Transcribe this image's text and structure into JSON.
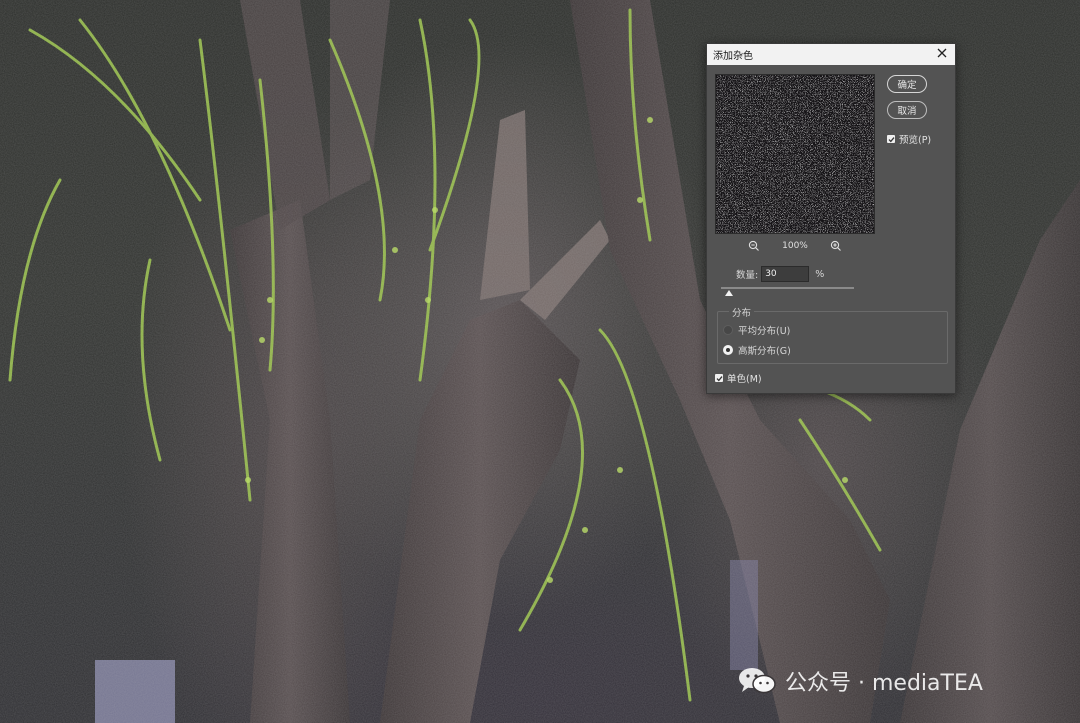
{
  "dialog": {
    "title": "添加杂色",
    "close_icon": "close-icon",
    "ok_label": "确定",
    "cancel_label": "取消",
    "preview_label": "预览(P)",
    "preview_checked": true,
    "zoom_level": "100%",
    "zoom_out_icon": "zoom-out-icon",
    "zoom_in_icon": "zoom-in-icon",
    "amount_label": "数量:",
    "amount_value": "30",
    "amount_unit": "%",
    "amount_slider_fraction": 0.06,
    "distribution": {
      "label": "分布",
      "options": [
        {
          "label": "平均分布(U)",
          "selected": false
        },
        {
          "label": "高斯分布(G)",
          "selected": true
        }
      ]
    },
    "monochrome_label": "单色(M)",
    "monochrome_checked": true
  },
  "watermark": {
    "text": "公众号 · mediaTEA",
    "icon": "wechat-icon"
  }
}
